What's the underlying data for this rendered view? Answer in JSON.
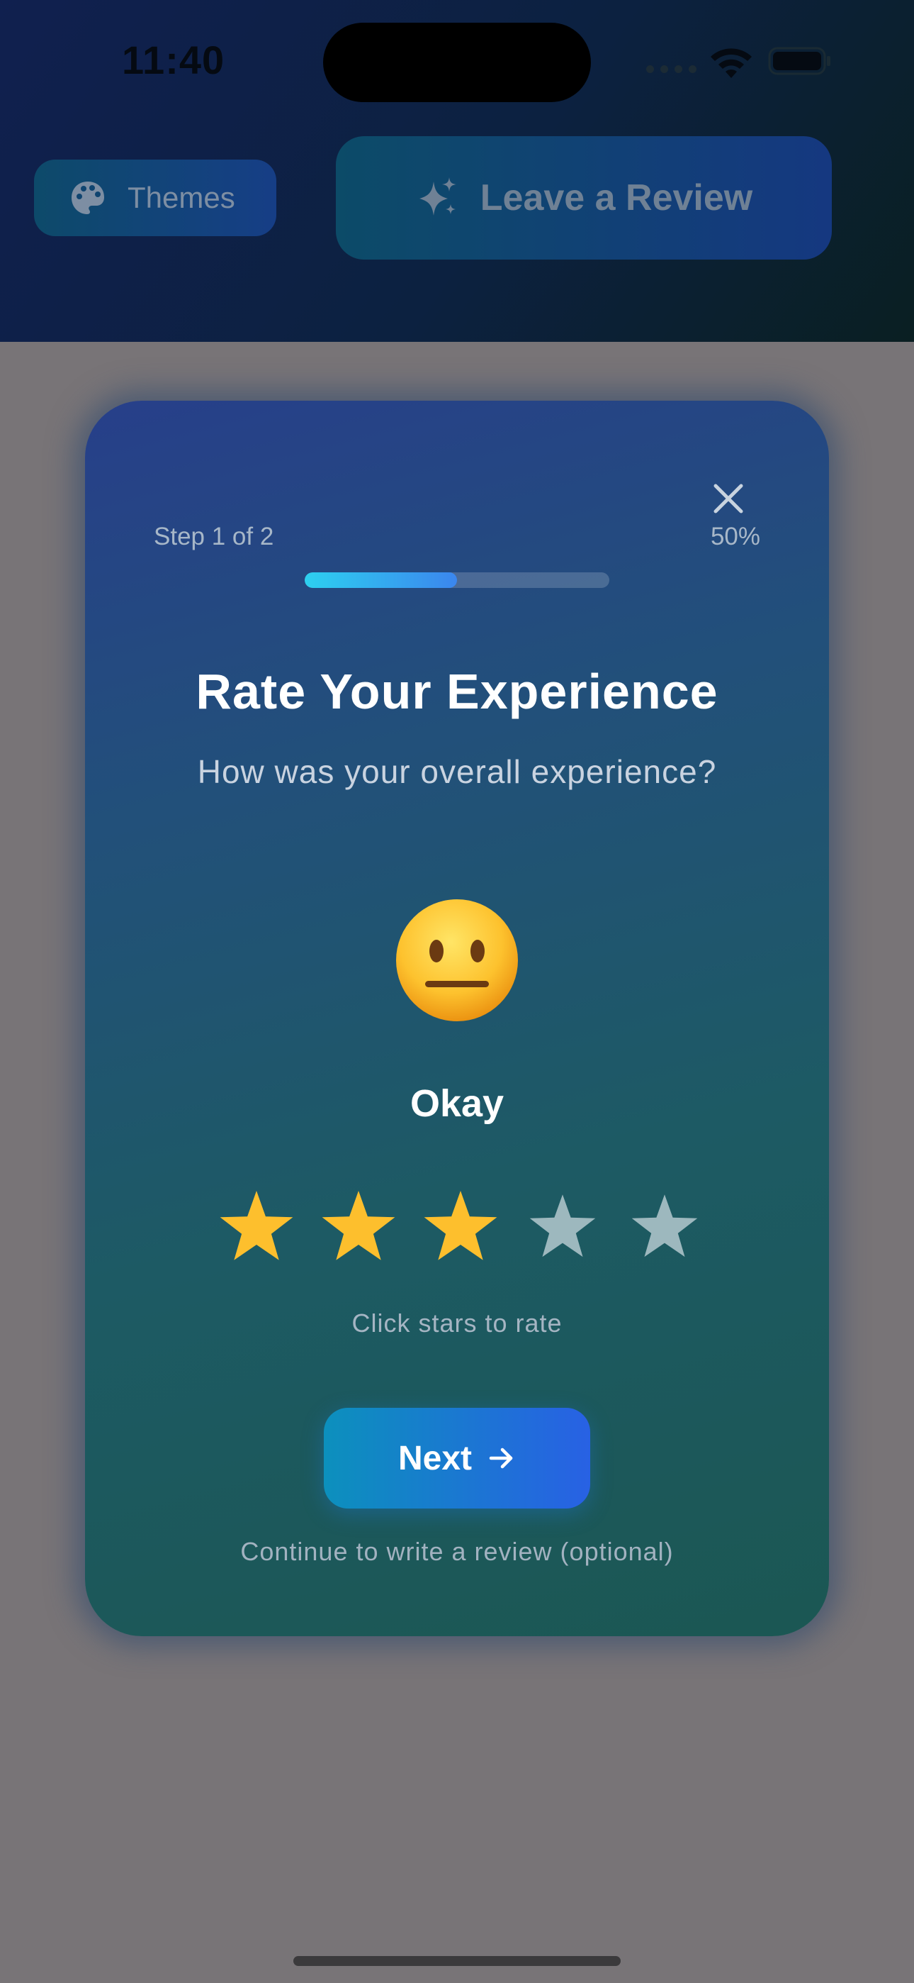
{
  "status_bar": {
    "time": "11:40"
  },
  "header": {
    "themes_label": "Themes",
    "themes_icon": "palette-icon",
    "review_label": "Leave a Review",
    "review_icon": "sparkles-icon"
  },
  "modal": {
    "close_icon": "close-icon",
    "step_label": "Step 1 of 2",
    "percent_label": "50%",
    "progress_fraction": 0.5,
    "title": "Rate Your Experience",
    "subtitle": "How was your overall experience?",
    "emoji": "neutral-face-emoji",
    "rating_label": "Okay",
    "rating": 3,
    "max_rating": 5,
    "stars_hint": "Click stars to rate",
    "next_label": "Next",
    "next_icon": "arrow-right-icon",
    "next_hint": "Continue to write a review (optional)"
  },
  "colors": {
    "star_filled": "#FDBF2D",
    "star_empty": "#9DB8BE",
    "accent_start": "#0C90BD",
    "accent_end": "#2861E4",
    "overlay": "#787477"
  }
}
